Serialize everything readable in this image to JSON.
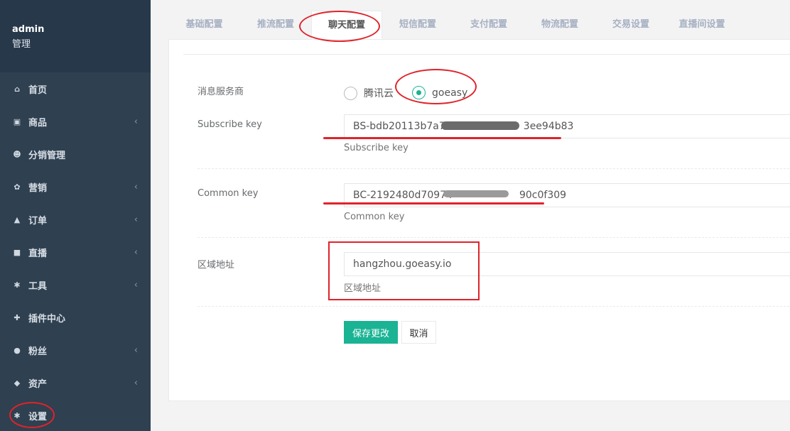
{
  "sidebar": {
    "user": "admin",
    "role": "管理",
    "items": [
      {
        "label": "首页",
        "icon": "home-icon",
        "glyph": "⌂",
        "chev": false
      },
      {
        "label": "商品",
        "icon": "product-icon",
        "glyph": "▣",
        "chev": true
      },
      {
        "label": "分销管理",
        "icon": "users-icon",
        "glyph": "☻",
        "chev": false
      },
      {
        "label": "营销",
        "icon": "gift-icon",
        "glyph": "✿",
        "chev": true
      },
      {
        "label": "订单",
        "icon": "bag-icon",
        "glyph": "▲",
        "chev": true
      },
      {
        "label": "直播",
        "icon": "video-icon",
        "glyph": "■",
        "chev": true
      },
      {
        "label": "工具",
        "icon": "gear-icon",
        "glyph": "✱",
        "chev": true
      },
      {
        "label": "插件中心",
        "icon": "puzzle-icon",
        "glyph": "✚",
        "chev": false
      },
      {
        "label": "粉丝",
        "icon": "user-icon",
        "glyph": "●",
        "chev": true
      },
      {
        "label": "资产",
        "icon": "diamond-icon",
        "glyph": "◆",
        "chev": true
      },
      {
        "label": "设置",
        "icon": "settings-icon",
        "glyph": "✱",
        "chev": false
      }
    ],
    "chevron": "‹"
  },
  "tabs": [
    "基础配置",
    "推流配置",
    "聊天配置",
    "短信配置",
    "支付配置",
    "物流配置",
    "交易设置",
    "直播间设置"
  ],
  "active_tab": "聊天配置",
  "form": {
    "provider_label": "消息服务商",
    "provider_options": [
      "腾讯云",
      "goeasy"
    ],
    "provider_selected": "goeasy",
    "subscribe_label": "Subscribe key",
    "subscribe_value": "BS-bdb20113b7a7",
    "subscribe_value_end": "3ee94b83",
    "subscribe_help": "Subscribe key",
    "common_label": "Common key",
    "common_value": "BC-2192480d70974",
    "common_value_end": "90c0f309",
    "common_help": "Common key",
    "region_label": "区域地址",
    "region_value": "hangzhou.goeasy.io",
    "region_help": "区域地址",
    "save_label": "保存更改",
    "cancel_label": "取消"
  },
  "colors": {
    "accent": "#1ab394",
    "sidebar": "#2f4050",
    "annotation": "#e0232a"
  }
}
